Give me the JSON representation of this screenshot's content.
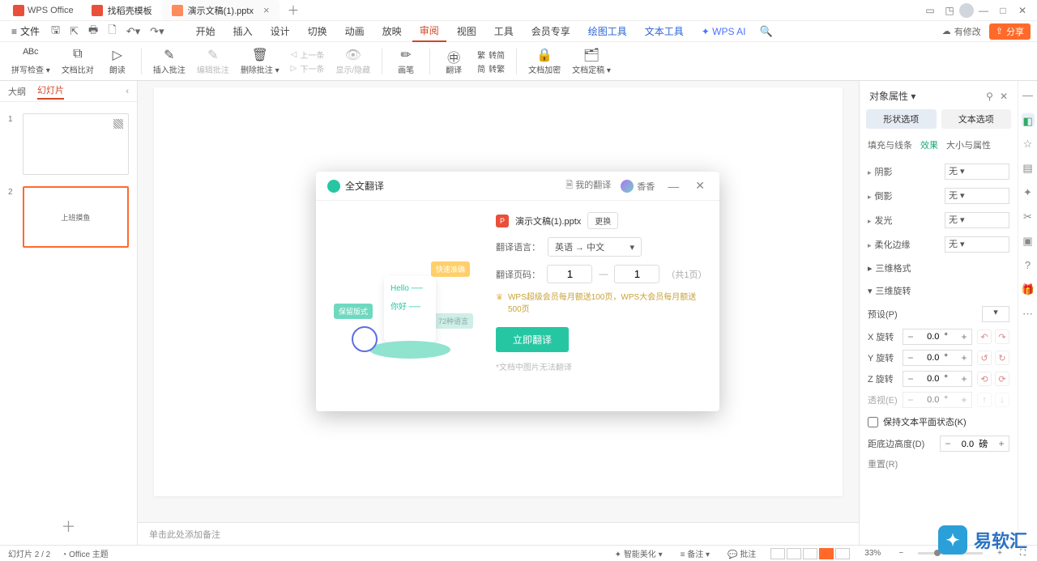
{
  "titlebar": {
    "app_name": "WPS Office",
    "tabs": [
      {
        "label": "找稻壳模板",
        "icon_color": "#e94f3a"
      },
      {
        "label": "演示文稿(1).pptx",
        "icon_color": "#e94f3a",
        "active": true
      }
    ]
  },
  "menubar": {
    "file_label": "文件",
    "tabs": [
      "开始",
      "插入",
      "设计",
      "切换",
      "动画",
      "放映",
      "审阅",
      "视图",
      "工具",
      "会员专享"
    ],
    "extra_tabs": [
      "绘图工具",
      "文本工具"
    ],
    "active_tab": "审阅",
    "ai_label": "WPS AI",
    "changes_label": "有修改",
    "share_label": "分享"
  },
  "ribbon": {
    "items": [
      {
        "label": "拼写检查",
        "dd": true
      },
      {
        "label": "文档比对"
      },
      {
        "label": "朗读"
      },
      {
        "label": "插入批注"
      },
      {
        "label": "编辑批注",
        "disabled": true
      },
      {
        "label": "删除批注",
        "dd": true
      },
      {
        "label": "上一条",
        "disabled": true,
        "stack_top": true
      },
      {
        "label": "下一条",
        "disabled": true,
        "stack_bottom": true
      },
      {
        "label": "显示/隐藏",
        "disabled": true
      },
      {
        "label": "画笔"
      },
      {
        "label": "翻译"
      },
      {
        "label": "转简",
        "stack_top": true
      },
      {
        "label": "转繁",
        "stack_bottom": true
      },
      {
        "label": "文档加密"
      },
      {
        "label": "文档定稿",
        "dd": true
      }
    ]
  },
  "left": {
    "tabs": [
      "大纲",
      "幻灯片"
    ],
    "active_tab": "幻灯片",
    "slides": [
      {
        "num": "1",
        "text": ""
      },
      {
        "num": "2",
        "text": "上班摸鱼",
        "selected": true
      }
    ]
  },
  "notes_placeholder": "单击此处添加备注",
  "prop": {
    "title": "对象属性",
    "tabs": [
      "形状选项",
      "文本选项"
    ],
    "active_tab": "形状选项",
    "subtabs": [
      "填充与线条",
      "效果",
      "大小与属性"
    ],
    "active_subtab": "效果",
    "rows": {
      "shadow": "阴影",
      "shadow_val": "无",
      "refl": "倒影",
      "refl_val": "无",
      "glow": "发光",
      "glow_val": "无",
      "soft": "柔化边缘",
      "soft_val": "无",
      "threeD": "三维格式",
      "rot_title": "三维旋转",
      "preset": "预设(P)",
      "xrot": "X 旋转",
      "yrot": "Y 旋转",
      "zrot": "Z 旋转",
      "persp": "透视(E)",
      "xval": "0.0  °",
      "yval": "0.0  °",
      "zval": "0.0  °",
      "pval": "0.0  °",
      "keep_flat": "保持文本平面状态(K)",
      "dist_label": "距底边高度(D)",
      "dist_val": "0.0  磅",
      "reset": "重置(R)"
    }
  },
  "status": {
    "slide_info": "幻灯片 2 / 2",
    "theme": "Office 主题",
    "smart": "智能美化",
    "notes": "备注",
    "comments": "批注",
    "zoom": "33%"
  },
  "modal": {
    "title": "全文翻译",
    "my_trans": "我的翻译",
    "user": "香香",
    "filename": "演示文稿(1).pptx",
    "change": "更换",
    "lang_label": "翻译语言：",
    "lang_value": "英语 → 中文",
    "pg_label": "翻译页码：",
    "pg_from": "1",
    "pg_to": "1",
    "pg_total": "（共1页）",
    "vip_note": "WPS超级会员每月额送100页，WPS大会员每月额送500页",
    "translate_btn": "立即翻译",
    "foot_note": "*文档中图片无法翻译",
    "illus": {
      "hello": "Hello ──",
      "nihao": "你好 ──",
      "tag1": "快速准确",
      "tag2": "保留版式",
      "tag3": "72种语言"
    }
  },
  "watermark": "易软汇"
}
